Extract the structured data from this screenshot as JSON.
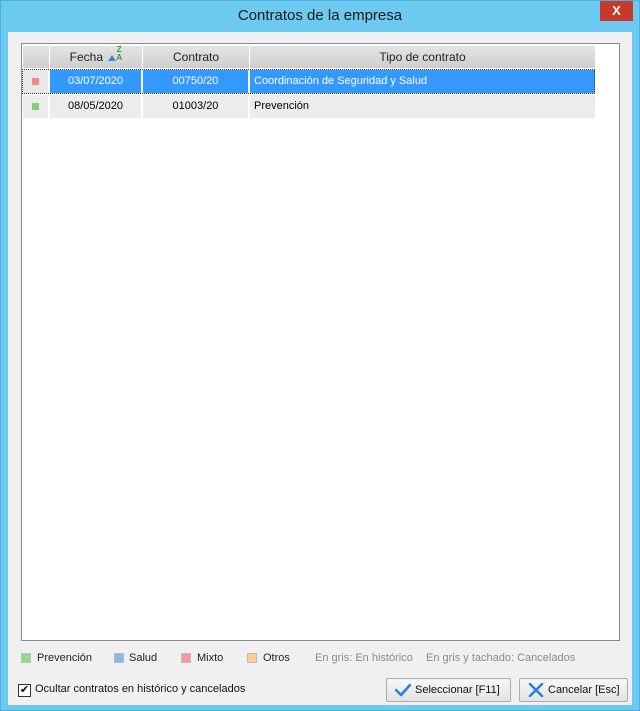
{
  "window": {
    "title": "Contratos de la empresa",
    "close_label": "X"
  },
  "grid": {
    "columns": [
      "",
      "Fecha",
      "Contrato",
      "Tipo de contrato"
    ],
    "sorted_column": "Fecha",
    "rows": [
      {
        "color": "#ef8a8a",
        "fecha": "03/07/2020",
        "contrato": "00750/20",
        "tipo": "Coordinación de Seguridad y Salud",
        "selected": true
      },
      {
        "color": "#7ed07e",
        "fecha": "08/05/2020",
        "contrato": "01003/20",
        "tipo": "Prevención",
        "selected": false
      }
    ]
  },
  "legend": {
    "items": [
      {
        "label": "Prevención",
        "color": "#8fdb8f"
      },
      {
        "label": "Salud",
        "color": "#8fb4ec"
      },
      {
        "label": "Mixto",
        "color": "#f09aa2"
      },
      {
        "label": "Otros",
        "color": "#f5cf94"
      }
    ],
    "note_historic": "En gris: En histórico",
    "note_cancelled": "En gris y tachado: Cancelados"
  },
  "footer": {
    "hide_checkbox_label": "Ocultar contratos en histórico y cancelados",
    "hide_checkbox_checked": true,
    "select_button": "Seleccionar  [F11]",
    "cancel_button": "Cancelar  [Esc]"
  }
}
